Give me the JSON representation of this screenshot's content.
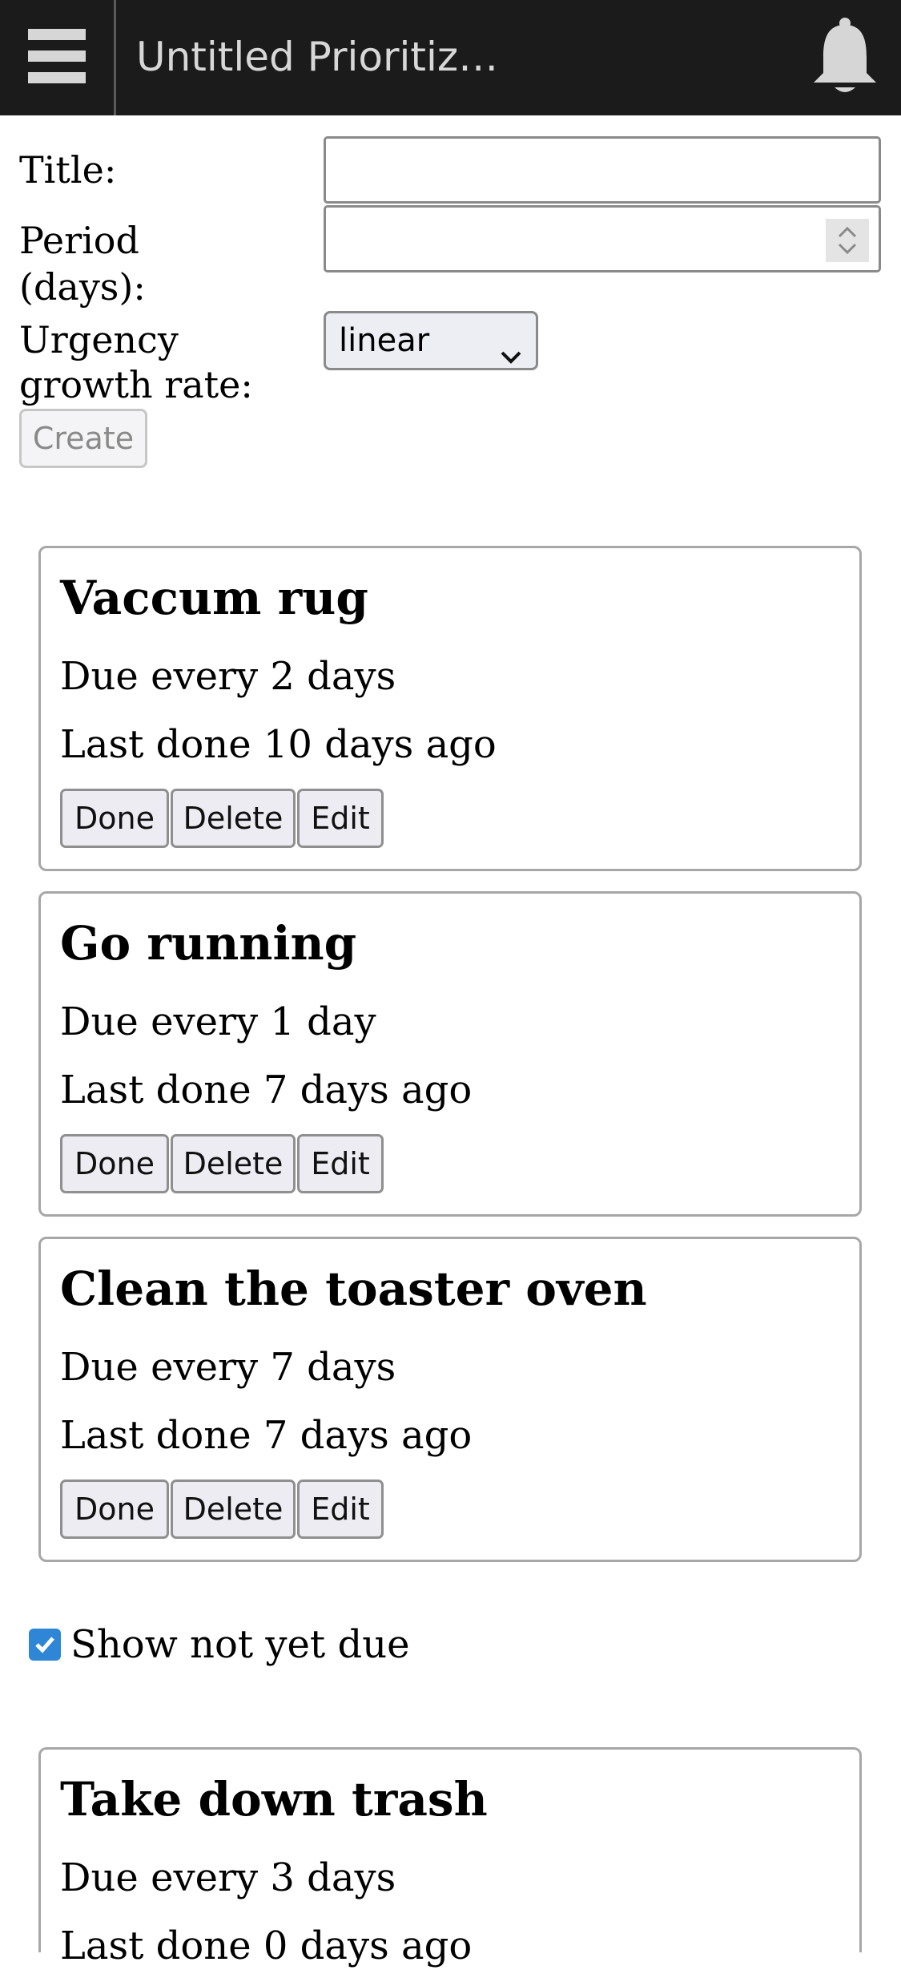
{
  "app": {
    "title": "Untitled Prioritiz…",
    "menu_icon": "hamburger-menu-icon",
    "notification_icon": "bell-icon"
  },
  "form": {
    "title_label": "Title:",
    "title_value": "",
    "period_label_line1": "Period",
    "period_label_line2": "(days):",
    "period_value": "",
    "urgency_label_line1": "Urgency",
    "urgency_label_line2": "growth rate:",
    "urgency_selected": "linear",
    "create_label": "Create"
  },
  "due_tasks": [
    {
      "title": "Vaccum rug",
      "due": "Due every 2 days",
      "last_done": "Last done 10 days ago"
    },
    {
      "title": "Go running",
      "due": "Due every 1 day",
      "last_done": "Last done 7 days ago"
    },
    {
      "title": "Clean the toaster oven",
      "due": "Due every 7 days",
      "last_done": "Last done 7 days ago"
    }
  ],
  "task_buttons": {
    "done": "Done",
    "delete": "Delete",
    "edit": "Edit"
  },
  "show_not_yet_due": {
    "label": "Show not yet due",
    "checked": true
  },
  "not_yet_due_tasks": [
    {
      "title": "Take down trash",
      "due": "Due every 3 days",
      "last_done": "Last done 0 days ago"
    }
  ],
  "colors": {
    "appbar": "#1b1b1b",
    "checkbox": "#2f86d6"
  }
}
